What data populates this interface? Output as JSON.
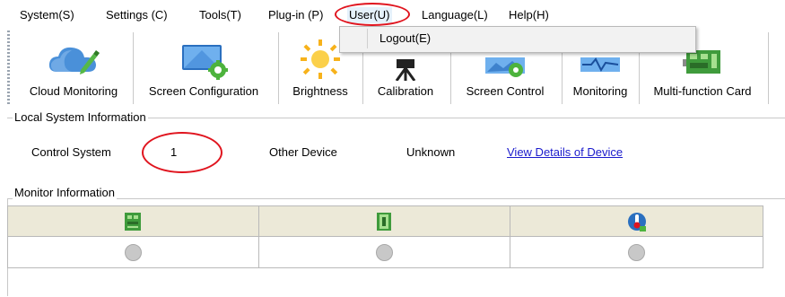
{
  "menubar": {
    "items": [
      {
        "label": "System(S)"
      },
      {
        "label": "Settings (C)"
      },
      {
        "label": "Tools(T)"
      },
      {
        "label": "Plug-in (P)"
      },
      {
        "label": "User(U)"
      },
      {
        "label": "Language(L)"
      },
      {
        "label": "Help(H)"
      }
    ]
  },
  "user_menu": {
    "items": [
      {
        "label": "Logout(E)"
      }
    ]
  },
  "toolbar": {
    "buttons": [
      {
        "label": "Cloud Monitoring",
        "icon": "cloud-monitoring-icon"
      },
      {
        "label": "Screen Configuration",
        "icon": "screen-configuration-icon"
      },
      {
        "label": "Brightness",
        "icon": "brightness-sun-icon"
      },
      {
        "label": "Calibration",
        "icon": "calibration-camera-icon"
      },
      {
        "label": "Screen Control",
        "icon": "screen-control-icon"
      },
      {
        "label": "Monitoring",
        "icon": "monitoring-icon"
      },
      {
        "label": "Multi-function Card",
        "icon": "multifunction-card-icon"
      }
    ]
  },
  "local_system": {
    "title": "Local System Information",
    "control_system_label": "Control System",
    "control_system_value": "1",
    "other_device_label": "Other Device",
    "other_device_value": "Unknown",
    "view_details_link": "View Details of Device"
  },
  "monitor": {
    "title": "Monitor Information",
    "columns": [
      {
        "icon": "receiving-card-icon",
        "status": "gray"
      },
      {
        "icon": "module-card-icon",
        "status": "gray"
      },
      {
        "icon": "temperature-icon",
        "status": "gray"
      }
    ]
  },
  "colors": {
    "highlight_circle": "#e0141e",
    "link": "#1a1acc",
    "toolbar_bg": "#ffffff",
    "table_header_bg": "#ece9d8"
  }
}
